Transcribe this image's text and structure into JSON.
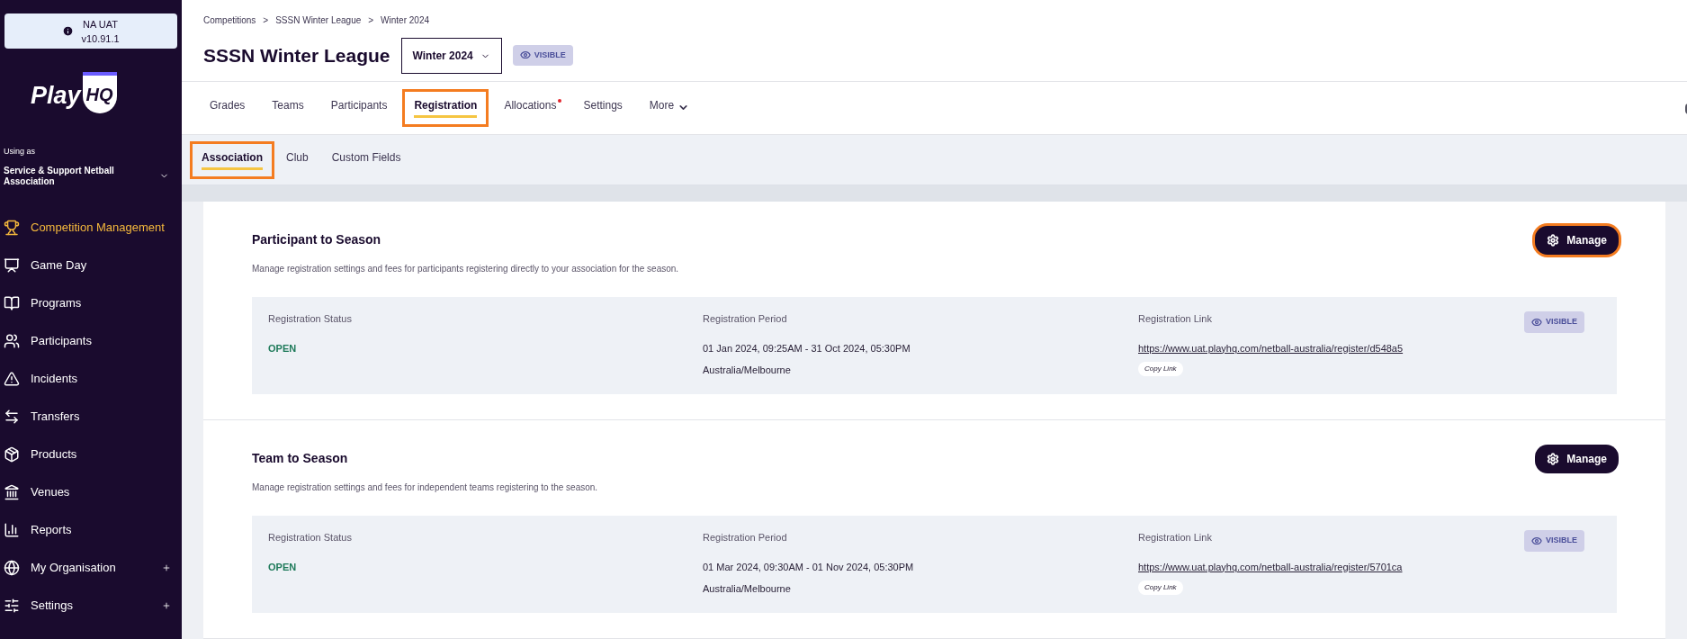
{
  "sidebar": {
    "environment": {
      "name": "NA UAT",
      "version": "v10.91.1"
    },
    "logo": {
      "word": "Play",
      "badge": "HQ"
    },
    "using_as_label": "Using as",
    "organisation": "Service & Support Netball Association",
    "nav": [
      {
        "label": "Competition Management",
        "selected": true,
        "expandable": false
      },
      {
        "label": "Game Day",
        "selected": false,
        "expandable": false
      },
      {
        "label": "Programs",
        "selected": false,
        "expandable": false
      },
      {
        "label": "Participants",
        "selected": false,
        "expandable": false
      },
      {
        "label": "Incidents",
        "selected": false,
        "expandable": false
      },
      {
        "label": "Transfers",
        "selected": false,
        "expandable": false
      },
      {
        "label": "Products",
        "selected": false,
        "expandable": false
      },
      {
        "label": "Venues",
        "selected": false,
        "expandable": false
      },
      {
        "label": "Reports",
        "selected": false,
        "expandable": false
      },
      {
        "label": "My Organisation",
        "selected": false,
        "expandable": true
      },
      {
        "label": "Settings",
        "selected": false,
        "expandable": true
      }
    ]
  },
  "breadcrumbs": [
    "Competitions",
    "SSSN Winter League",
    "Winter 2024"
  ],
  "breadcrumb_separator": ">",
  "title": "SSSN Winter League",
  "season_select": "Winter 2024",
  "visibility_badge": "VISIBLE",
  "tabs": [
    {
      "label": "Grades",
      "selected": false,
      "highlighted": false,
      "notification": false,
      "kind": "tab"
    },
    {
      "label": "Teams",
      "selected": false,
      "highlighted": false,
      "notification": false,
      "kind": "tab"
    },
    {
      "label": "Participants",
      "selected": false,
      "highlighted": false,
      "notification": false,
      "kind": "tab"
    },
    {
      "label": "Registration",
      "selected": true,
      "highlighted": true,
      "notification": false,
      "kind": "tab"
    },
    {
      "label": "Allocations",
      "selected": false,
      "highlighted": false,
      "notification": true,
      "kind": "tab"
    },
    {
      "label": "Settings",
      "selected": false,
      "highlighted": false,
      "notification": false,
      "kind": "tab"
    },
    {
      "label": "More",
      "selected": false,
      "highlighted": false,
      "notification": false,
      "kind": "menu"
    }
  ],
  "subtabs": [
    {
      "label": "Association",
      "selected": true,
      "highlighted": true
    },
    {
      "label": "Club",
      "selected": false,
      "highlighted": false
    },
    {
      "label": "Custom Fields",
      "selected": false,
      "highlighted": false
    }
  ],
  "sections": [
    {
      "title": "Participant to Season",
      "description": "Manage registration settings and fees for participants registering directly to your association for the season.",
      "manage_button": {
        "label": "Manage",
        "highlighted": true
      },
      "status_label": "Registration Status",
      "status": "OPEN",
      "period_label": "Registration Period",
      "period": "01 Jan 2024, 09:25AM - 31 Oct 2024, 05:30PM",
      "timezone": "Australia/Melbourne",
      "link_label": "Registration Link",
      "link": "https://www.uat.playhq.com/netball-australia/register/d548a5",
      "copy_button": "Copy Link",
      "badge": "VISIBLE"
    },
    {
      "title": "Team to Season",
      "description": "Manage registration settings and fees for independent teams registering to the season.",
      "manage_button": {
        "label": "Manage",
        "highlighted": false
      },
      "status_label": "Registration Status",
      "status": "OPEN",
      "period_label": "Registration Period",
      "period": "01 Mar 2024, 09:30AM - 01 Nov 2024, 05:30PM",
      "timezone": "Australia/Melbourne",
      "link_label": "Registration Link",
      "link": "https://www.uat.playhq.com/netball-australia/register/5701ca",
      "copy_button": "Copy Link",
      "badge": "VISIBLE"
    }
  ]
}
